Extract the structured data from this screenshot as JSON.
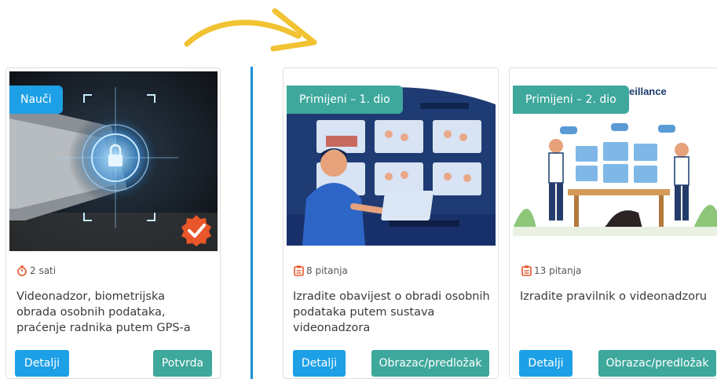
{
  "cards": [
    {
      "badge": "Nauči",
      "meta": "2 sati",
      "meta_icon": "stopwatch-icon",
      "title": "Videonadzor, biometrijska obrada osobnih podataka, praćenje radnika putem GPS-a",
      "btn_primary": "Detalji",
      "btn_secondary": "Potvrda",
      "completed": true
    },
    {
      "badge": "Primijeni – 1. dio",
      "meta": "8 pitanja",
      "meta_icon": "questionnaire-icon",
      "title": "Izradite obavijest o obradi osobnih podataka putem sustava videonadzora",
      "btn_primary": "Detalji",
      "btn_secondary": "Obrazac/predložak"
    },
    {
      "badge": "Primijeni – 2. dio",
      "image_text": "eillance",
      "meta": "13 pitanja",
      "meta_icon": "questionnaire-icon",
      "title": "Izradite pravilnik o videonadzoru",
      "btn_primary": "Detalji",
      "btn_secondary": "Obrazac/predložak"
    }
  ],
  "colors": {
    "badge_blue": "#1ea0e6",
    "badge_teal": "#3ea89c",
    "accent_orange": "#e8562a",
    "divider": "#1a8fd6",
    "arrow": "#f1c232"
  }
}
